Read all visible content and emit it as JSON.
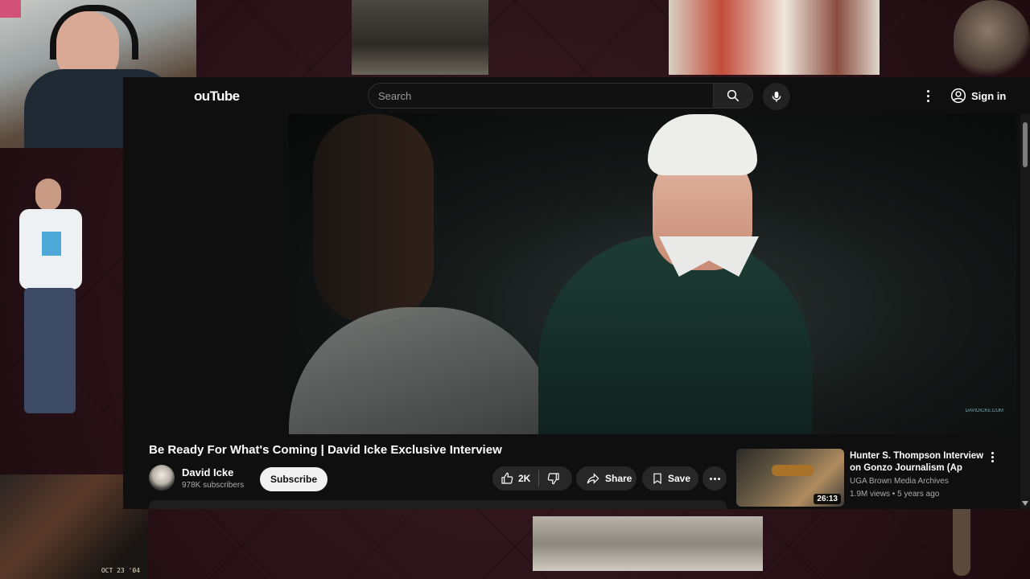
{
  "youtube": {
    "logo_text": "ouTube",
    "search": {
      "placeholder": "Search"
    },
    "signin_label": "Sign in",
    "video": {
      "title": "Be Ready For What's Coming | David Icke Exclusive Interview",
      "watermark": "DAVIDICKE.COM",
      "channel": {
        "name": "David Icke",
        "subscribers": "978K subscribers"
      },
      "subscribe_label": "Subscribe",
      "likes": "2K",
      "share_label": "Share",
      "save_label": "Save"
    },
    "recommended": [
      {
        "title": "Hunter S. Thompson Interview on Gonzo Journalism (Ap",
        "channel": "UGA Brown Media Archives",
        "meta": "1.9M views • 5 years ago",
        "duration": "26:13"
      }
    ]
  },
  "overlays": {
    "photo_date_stamp": "OCT 23 '04"
  },
  "icons": [
    "search-icon",
    "mic-icon",
    "more-vert-icon",
    "account-circle-icon",
    "thumb-up-icon",
    "thumb-down-icon",
    "share-icon",
    "bookmark-icon",
    "more-horiz-icon"
  ],
  "colors": {
    "background": "#2a1218",
    "yt_bg": "#0f0f0f",
    "pill": "#272727",
    "subscribe_bg": "#f1f1f1"
  }
}
